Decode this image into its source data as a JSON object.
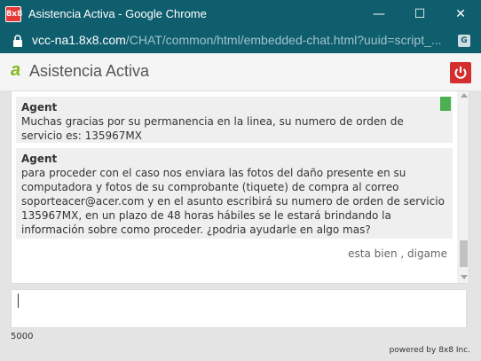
{
  "window": {
    "app_icon_label": "8x8",
    "title": "Asistencia Activa - Google Chrome",
    "minimize_glyph": "—",
    "maximize_glyph": "☐",
    "close_glyph": "✕"
  },
  "address": {
    "host": "vcc-na1.8x8.com",
    "path": "/CHAT/common/html/embedded-chat.html?uuid=script_...",
    "translate_label": "G"
  },
  "header": {
    "brand_glyph": "a",
    "title": "Asistencia Activa"
  },
  "messages": [
    {
      "sender": "Agent",
      "text": "Muchas gracias por su permanencia en la linea, su numero de orden de servicio es: 135967MX"
    },
    {
      "sender": "Agent",
      "text": "para proceder con el caso nos enviara las fotos del daño presente en su computadora y fotos de su comprobante (tiquete) de compra al correo soporteacer@acer.com y en el asunto escribirá su numero de orden de servicio 135967MX, en un plazo de 48 horas hábiles se le estará brindando la información sobre como proceder. ¿podria ayudarle en algo mas?"
    }
  ],
  "user_reply": "esta bien , digame",
  "input": {
    "value": "",
    "char_limit": "5000"
  },
  "footer": {
    "powered_by": "powered by 8x8 Inc."
  },
  "colors": {
    "titlebar": "#0f5e6e",
    "brand": "#83b81a",
    "power": "#d32f2f",
    "bookmark": "#4caf50"
  }
}
